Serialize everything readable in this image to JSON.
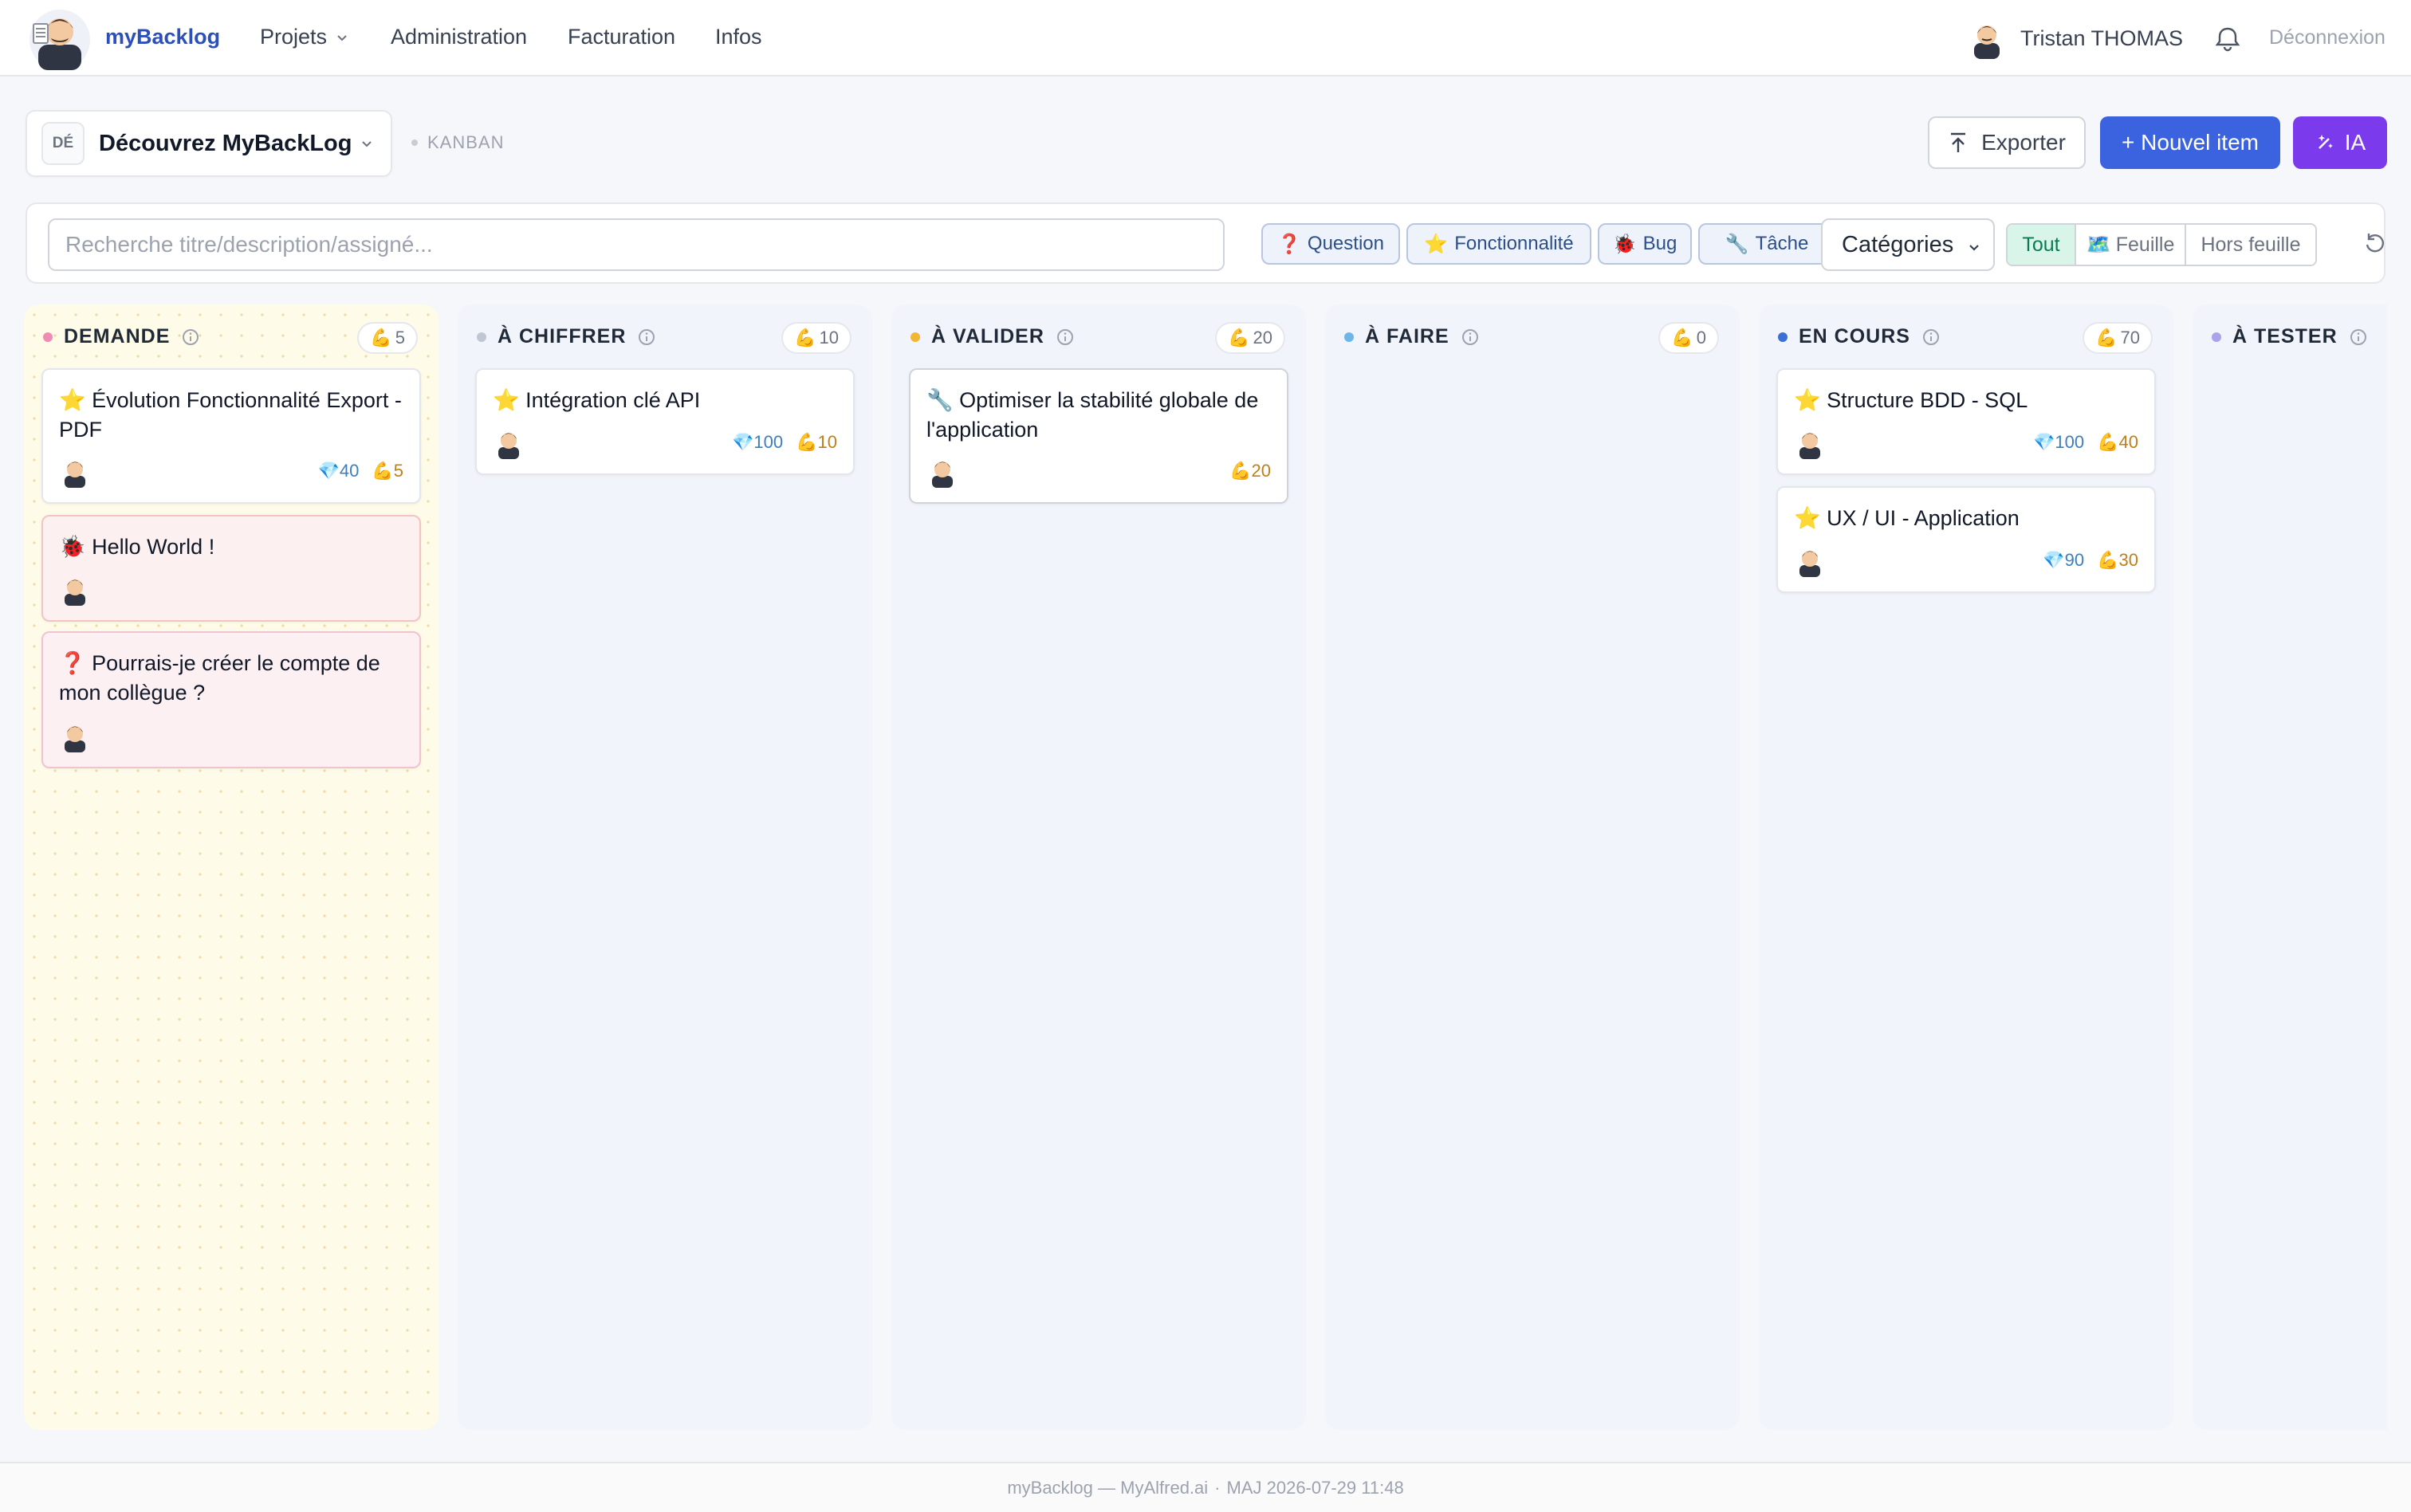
{
  "nav": {
    "brand": "myBacklog",
    "items": [
      {
        "label": "Projets"
      },
      {
        "label": "Administration"
      },
      {
        "label": "Facturation"
      },
      {
        "label": "Infos"
      }
    ],
    "user_name": "Tristan THOMAS",
    "logout": "Déconnexion"
  },
  "project": {
    "badge": "DÉ",
    "name": "Découvrez MyBackLog",
    "view": "KANBAN"
  },
  "actions": {
    "export": "Exporter",
    "new_item": "+ Nouvel item",
    "ia": "IA"
  },
  "filters": {
    "search_placeholder": "Recherche titre/description/assigné...",
    "chips": [
      {
        "icon": "❓",
        "label": "Question"
      },
      {
        "icon": "⭐",
        "label": "Fonctionnalité"
      },
      {
        "icon": "🐞",
        "label": "Bug"
      },
      {
        "icon": "🔧",
        "label": "Tâche"
      }
    ],
    "category_select": "Catégories",
    "scope": [
      {
        "label": "Tout"
      },
      {
        "icon": "🗺️",
        "label": "Feuille"
      },
      {
        "label": "Hors feuille"
      }
    ]
  },
  "columns": [
    {
      "title": "DEMANDE",
      "dot_color": "#f08cb4",
      "effort_icon": "💪",
      "effort_total": "5",
      "cards": [
        {
          "type": "feature",
          "icon": "⭐",
          "title": "Évolution Fonctionnalité Export - PDF",
          "value": "40",
          "effort": "5"
        },
        {
          "type": "bug",
          "icon": "🐞",
          "title": "Hello World !"
        },
        {
          "type": "question",
          "icon": "❓",
          "title": "Pourrais-je créer le compte de mon collègue ?"
        }
      ]
    },
    {
      "title": "À CHIFFRER",
      "dot_color": "#c0c6d2",
      "effort_icon": "💪",
      "effort_total": "10",
      "cards": [
        {
          "type": "feature",
          "icon": "⭐",
          "title": "Intégration clé API",
          "value": "100",
          "effort": "10"
        }
      ]
    },
    {
      "title": "À VALIDER",
      "dot_color": "#f2b632",
      "effort_icon": "💪",
      "effort_total": "20",
      "cards": [
        {
          "type": "task",
          "icon": "🔧",
          "title": "Optimiser la stabilité globale de l'application",
          "effort": "20"
        }
      ]
    },
    {
      "title": "À FAIRE",
      "dot_color": "#6cb7ea",
      "effort_icon": "💪",
      "effort_total": "0",
      "cards": []
    },
    {
      "title": "EN COURS",
      "dot_color": "#3b6fd8",
      "effort_icon": "💪",
      "effort_total": "70",
      "cards": [
        {
          "type": "feature",
          "icon": "⭐",
          "title": "Structure BDD - SQL",
          "value": "100",
          "effort": "40"
        },
        {
          "type": "feature",
          "icon": "⭐",
          "title": "UX / UI - Application",
          "value": "90",
          "effort": "30"
        }
      ]
    },
    {
      "title": "À TESTER",
      "dot_color": "#a9a3ec",
      "cards": []
    }
  ],
  "metric_icons": {
    "value": "💎",
    "effort": "💪"
  },
  "footer": {
    "app": "myBacklog — MyAlfred.ai",
    "separator": "·",
    "updated": "MAJ 2026-07-29 11:48"
  }
}
